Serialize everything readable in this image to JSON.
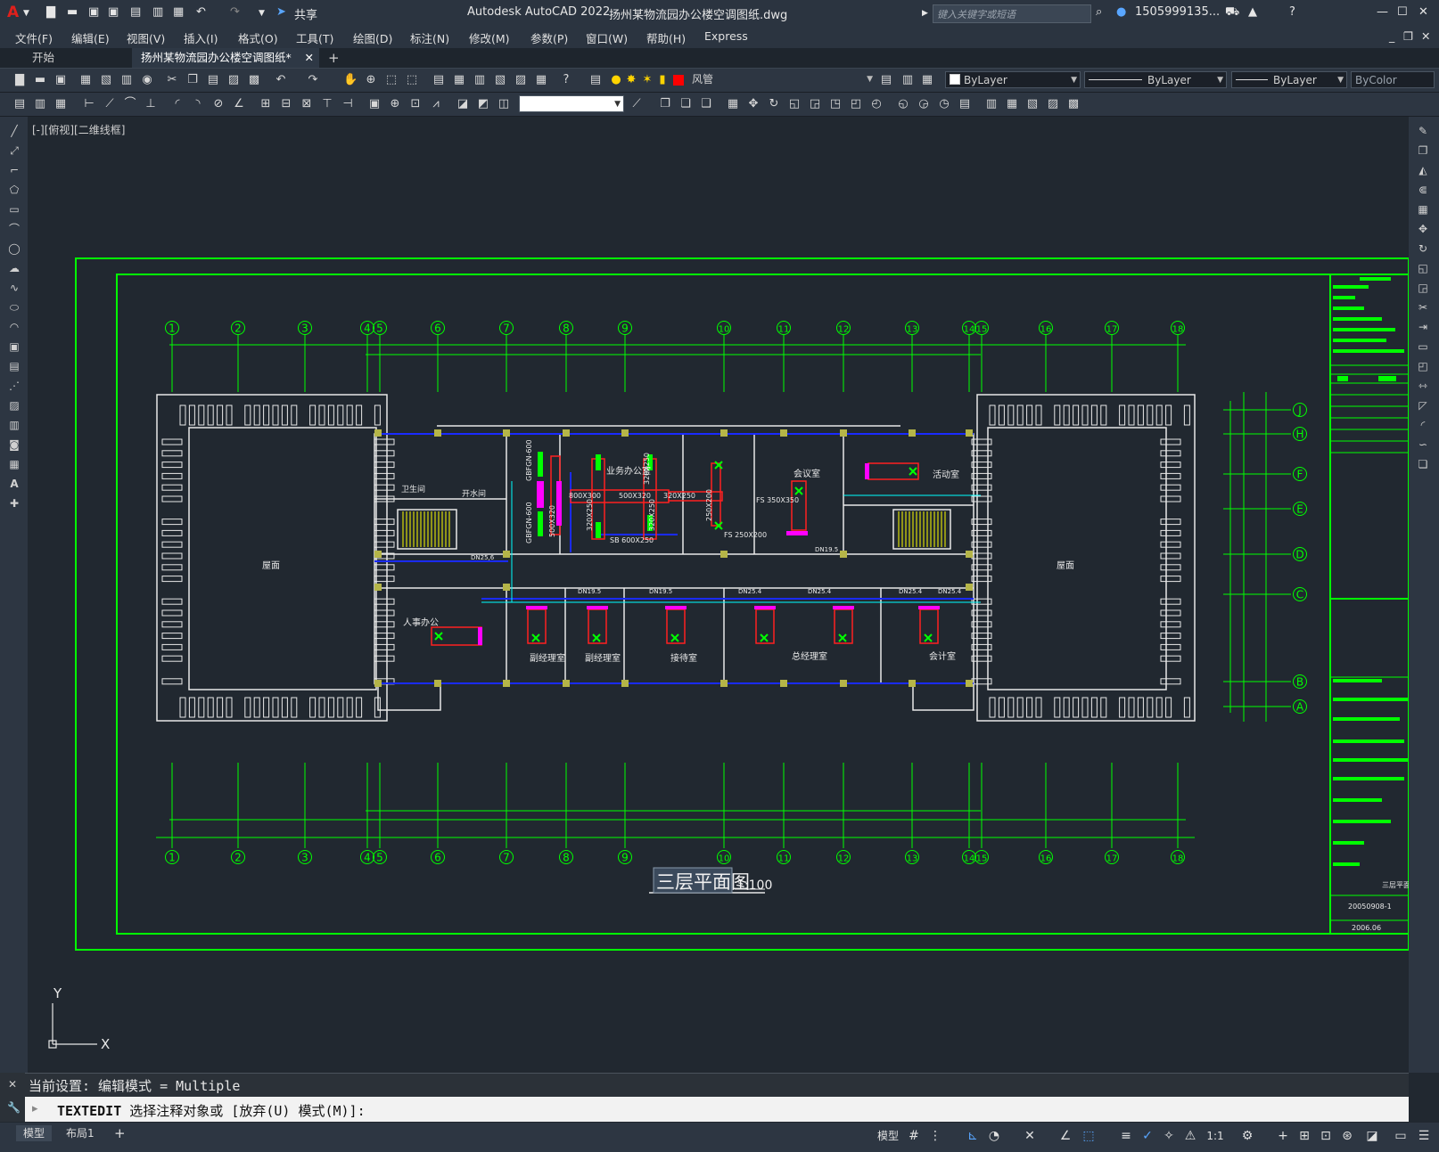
{
  "app": {
    "logo": "A",
    "title": "Autodesk AutoCAD 2022",
    "filename": "扬州某物流园办公楼空调图纸.dwg",
    "share_label": "共享",
    "search_placeholder": "键入关键字或短语",
    "user": "1505999135...",
    "colors": {
      "accent": "#e0201c",
      "cad_bg": "#212830",
      "green": "#00ff00",
      "blue": "#1a2bff",
      "cyan": "#00ffff",
      "magenta": "#ff00ff",
      "red": "#ff0000"
    }
  },
  "menu": [
    "文件(F)",
    "编辑(E)",
    "视图(V)",
    "插入(I)",
    "格式(O)",
    "工具(T)",
    "绘图(D)",
    "标注(N)",
    "修改(M)",
    "参数(P)",
    "窗口(W)",
    "帮助(H)",
    "Express"
  ],
  "tabs": {
    "start": "开始",
    "file": "扬州某物流园办公楼空调图纸*",
    "add": "+"
  },
  "properties": {
    "layer": "风管",
    "color": "ByLayer",
    "linetype": "ByLayer",
    "lineweight": "ByLayer",
    "plotstyle": "ByColor"
  },
  "viewport_label": "[-][俯视][二维线框]",
  "drawing": {
    "title": "三层平面图",
    "scale": "1:100",
    "grid_columns": [
      "1",
      "2",
      "3",
      "4",
      "5",
      "6",
      "7",
      "8",
      "9",
      "10",
      "11",
      "12",
      "13",
      "14",
      "15",
      "16",
      "17",
      "18"
    ],
    "grid_rows": [
      "J",
      "H",
      "F",
      "E",
      "D",
      "C",
      "B",
      "A"
    ],
    "rooms": [
      "屋面",
      "屋面",
      "卫生间",
      "开水间",
      "业务办公室",
      "会议室",
      "活动室",
      "人事办公",
      "副经理室",
      "副经理室",
      "接待室",
      "总经理室",
      "会计室"
    ],
    "duct_labels": [
      "800X300",
      "500X320",
      "320X250",
      "320X250",
      "250X200",
      "FS 350X350",
      "FS 250X200",
      "SB 600X250",
      "GBFGN-600",
      "GBFGN-600",
      "320X250",
      "320X250",
      "500X320"
    ],
    "pipe_labels": [
      "DN25,6",
      "DN19.5",
      "DN19.5",
      "DN25.4",
      "DN25.4",
      "DN25.4",
      "DN25.4",
      "DN19.5"
    ],
    "title_block": {
      "drawing_name": "三层平面",
      "number": "20050908-1",
      "date": "2006.06"
    }
  },
  "ucs": {
    "x": "X",
    "y": "Y"
  },
  "command": {
    "history": "当前设置: 编辑模式 = Multiple",
    "prompt_cmd": "TEXTEDIT",
    "prompt_text": "选择注释对象或 [放弃(U) 模式(M)]:"
  },
  "status": {
    "model_tab": "模型",
    "layout_tab": "布局1",
    "add": "+",
    "space": "模型",
    "scale": "1:1"
  }
}
